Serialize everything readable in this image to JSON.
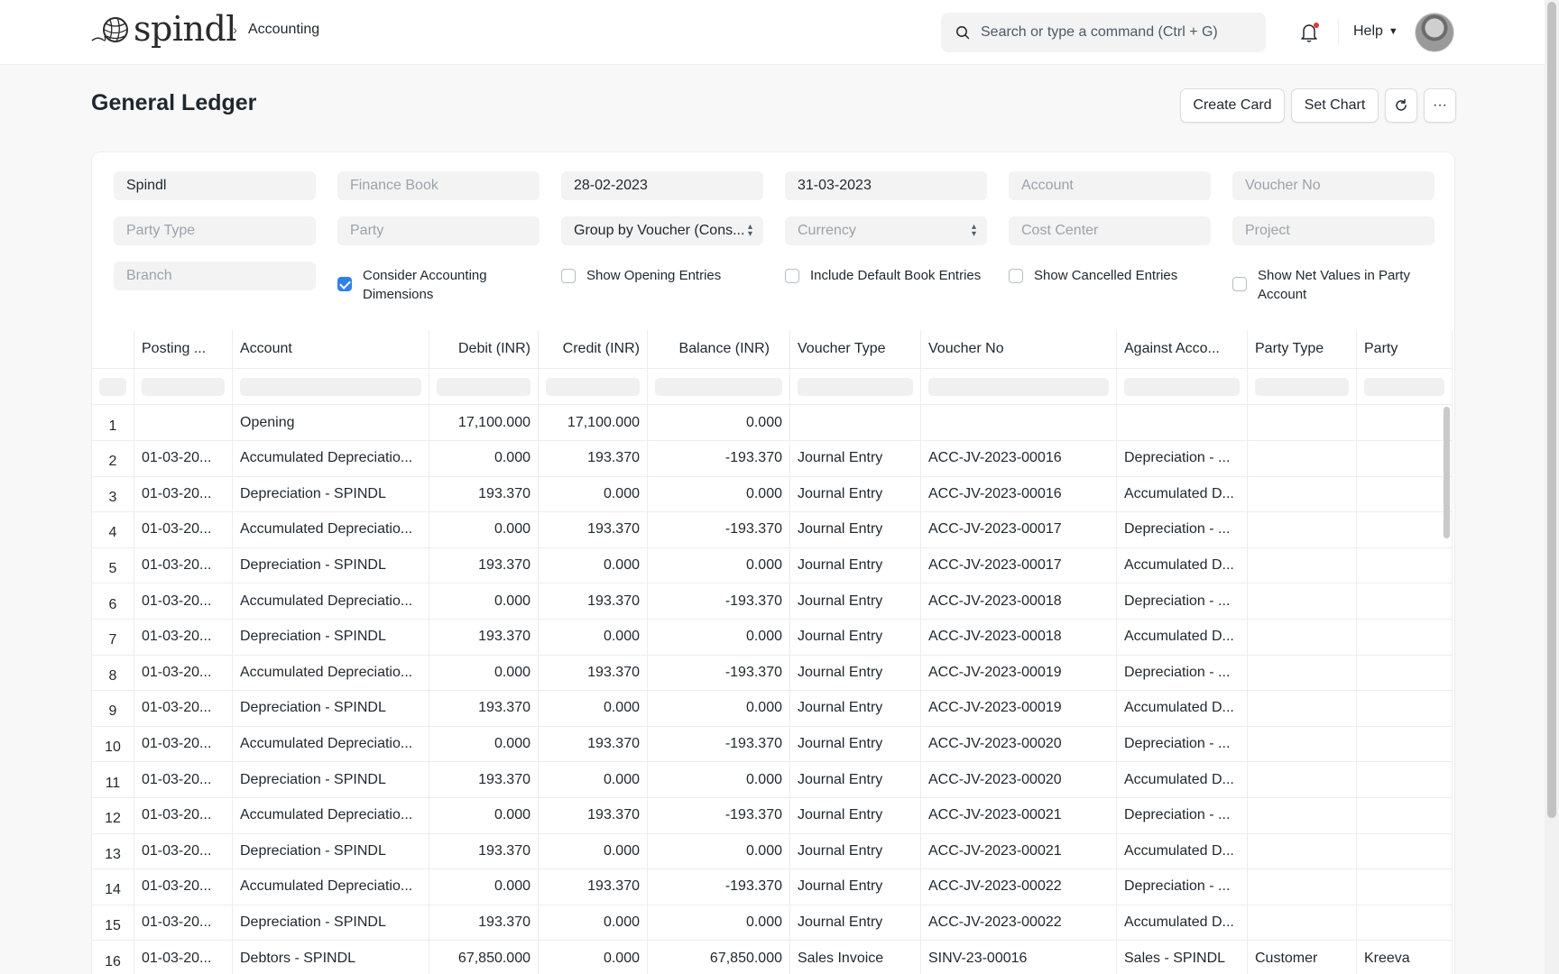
{
  "navbar": {
    "logo_text": "spindl",
    "breadcrumb": "Accounting",
    "search_placeholder": "Search or type a command (Ctrl + G)",
    "help_label": "Help",
    "notification_dot_color": "#e03636"
  },
  "page": {
    "title": "General Ledger",
    "buttons": {
      "create_card": "Create Card",
      "set_chart": "Set Chart",
      "more": "···"
    }
  },
  "filters": {
    "company": "Spindl",
    "finance_book": "Finance Book",
    "from_date": "28-02-2023",
    "to_date": "31-03-2023",
    "account": "Account",
    "voucher_no": "Voucher No",
    "party_type": "Party Type",
    "party": "Party",
    "group_by": "Group by Voucher (Cons...",
    "currency": "Currency",
    "cost_center": "Cost Center",
    "project": "Project",
    "branch": "Branch"
  },
  "checkboxes": [
    {
      "label": "Consider Accounting Dimensions",
      "checked": true
    },
    {
      "label": "Show Opening Entries",
      "checked": false
    },
    {
      "label": "Include Default Book Entries",
      "checked": false
    },
    {
      "label": "Show Cancelled Entries",
      "checked": false
    },
    {
      "label": "Show Net Values in Party Account",
      "checked": false
    }
  ],
  "table": {
    "columns": [
      "Posting ...",
      "Account",
      "Debit (INR)",
      "Credit (INR)",
      "Balance (INR)",
      "Voucher Type",
      "Voucher No",
      "Against Acco...",
      "Party Type",
      "Party"
    ],
    "rows": [
      [
        "1",
        "",
        "Opening",
        "17,100.000",
        "17,100.000",
        "0.000",
        "",
        "",
        "",
        "",
        ""
      ],
      [
        "2",
        "01-03-20...",
        "Accumulated Depreciatio...",
        "0.000",
        "193.370",
        "-193.370",
        "Journal Entry",
        "ACC-JV-2023-00016",
        "Depreciation - ...",
        "",
        ""
      ],
      [
        "3",
        "01-03-20...",
        "Depreciation - SPINDL",
        "193.370",
        "0.000",
        "0.000",
        "Journal Entry",
        "ACC-JV-2023-00016",
        "Accumulated D...",
        "",
        ""
      ],
      [
        "4",
        "01-03-20...",
        "Accumulated Depreciatio...",
        "0.000",
        "193.370",
        "-193.370",
        "Journal Entry",
        "ACC-JV-2023-00017",
        "Depreciation - ...",
        "",
        ""
      ],
      [
        "5",
        "01-03-20...",
        "Depreciation - SPINDL",
        "193.370",
        "0.000",
        "0.000",
        "Journal Entry",
        "ACC-JV-2023-00017",
        "Accumulated D...",
        "",
        ""
      ],
      [
        "6",
        "01-03-20...",
        "Accumulated Depreciatio...",
        "0.000",
        "193.370",
        "-193.370",
        "Journal Entry",
        "ACC-JV-2023-00018",
        "Depreciation - ...",
        "",
        ""
      ],
      [
        "7",
        "01-03-20...",
        "Depreciation - SPINDL",
        "193.370",
        "0.000",
        "0.000",
        "Journal Entry",
        "ACC-JV-2023-00018",
        "Accumulated D...",
        "",
        ""
      ],
      [
        "8",
        "01-03-20...",
        "Accumulated Depreciatio...",
        "0.000",
        "193.370",
        "-193.370",
        "Journal Entry",
        "ACC-JV-2023-00019",
        "Depreciation - ...",
        "",
        ""
      ],
      [
        "9",
        "01-03-20...",
        "Depreciation - SPINDL",
        "193.370",
        "0.000",
        "0.000",
        "Journal Entry",
        "ACC-JV-2023-00019",
        "Accumulated D...",
        "",
        ""
      ],
      [
        "10",
        "01-03-20...",
        "Accumulated Depreciatio...",
        "0.000",
        "193.370",
        "-193.370",
        "Journal Entry",
        "ACC-JV-2023-00020",
        "Depreciation - ...",
        "",
        ""
      ],
      [
        "11",
        "01-03-20...",
        "Depreciation - SPINDL",
        "193.370",
        "0.000",
        "0.000",
        "Journal Entry",
        "ACC-JV-2023-00020",
        "Accumulated D...",
        "",
        ""
      ],
      [
        "12",
        "01-03-20...",
        "Accumulated Depreciatio...",
        "0.000",
        "193.370",
        "-193.370",
        "Journal Entry",
        "ACC-JV-2023-00021",
        "Depreciation - ...",
        "",
        ""
      ],
      [
        "13",
        "01-03-20...",
        "Depreciation - SPINDL",
        "193.370",
        "0.000",
        "0.000",
        "Journal Entry",
        "ACC-JV-2023-00021",
        "Accumulated D...",
        "",
        ""
      ],
      [
        "14",
        "01-03-20...",
        "Accumulated Depreciatio...",
        "0.000",
        "193.370",
        "-193.370",
        "Journal Entry",
        "ACC-JV-2023-00022",
        "Depreciation - ...",
        "",
        ""
      ],
      [
        "15",
        "01-03-20...",
        "Depreciation - SPINDL",
        "193.370",
        "0.000",
        "0.000",
        "Journal Entry",
        "ACC-JV-2023-00022",
        "Accumulated D...",
        "",
        ""
      ],
      [
        "16",
        "01-03-20...",
        "Debtors - SPINDL",
        "67,850.000",
        "0.000",
        "67,850.000",
        "Sales Invoice",
        "SINV-23-00016",
        "Sales - SPINDL",
        "Customer",
        "Kreeva"
      ]
    ]
  },
  "icons": {
    "search": "search-icon",
    "bell": "bell-icon",
    "refresh": "refresh-icon",
    "chevron": "chevron-right-icon"
  },
  "colors": {
    "checkbox_accent": "#2f80ed"
  }
}
